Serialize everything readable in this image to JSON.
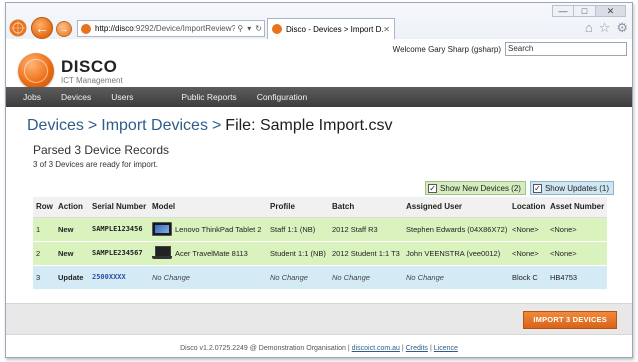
{
  "browser": {
    "address": {
      "host": "http://disco",
      "rest": ":9292/Device/ImportReview?Imp"
    },
    "address_icons": [
      "search-icon",
      "dropdown-icon",
      "refresh-icon"
    ],
    "tab_title": "Disco - Devices > Import D...",
    "chrome_icons": [
      "home-icon",
      "favorites-icon",
      "settings-icon"
    ]
  },
  "welcome": {
    "text": "Welcome Gary Sharp (gsharp)",
    "search_placeholder": "Search"
  },
  "brand": {
    "name": "DISCO",
    "subtitle": "ICT Management"
  },
  "menu": [
    "Jobs",
    "Devices",
    "Users",
    "Public Reports",
    "Configuration"
  ],
  "breadcrumb": {
    "link1": "Devices",
    "link2": "Import Devices",
    "separator": ">",
    "current": "File: Sample Import.csv"
  },
  "section": {
    "title": "Parsed 3 Device Records",
    "subtitle": "3 of 3 Devices are ready for import."
  },
  "toggles": {
    "show_new": "Show New Devices (2)",
    "show_updates": "Show Updates (1)",
    "show_new_checked": true,
    "show_updates_checked": true
  },
  "table": {
    "headers": [
      "Row",
      "Action",
      "Serial Number",
      "Model",
      "Profile",
      "Batch",
      "Assigned User",
      "Location",
      "Asset Number"
    ],
    "rows": [
      {
        "row": "1",
        "action": "New",
        "serial": "SAMPLE123456",
        "model": "Lenovo ThinkPad Tablet 2",
        "profile": "Staff 1:1 (NB)",
        "batch": "2012 Staff R3",
        "user": "Stephen Edwards (04X86X72)",
        "location": "<None>",
        "asset": "<None>"
      },
      {
        "row": "2",
        "action": "New",
        "serial": "SAMPLE234567",
        "model": "Acer TravelMate 8113",
        "profile": "Student 1:1 (NB)",
        "batch": "2012 Student 1:1 T3",
        "user": "John VEENSTRA (vee0012)",
        "location": "<None>",
        "asset": "<None>"
      },
      {
        "row": "3",
        "action": "Update",
        "serial": "2500XXXX",
        "model": "No Change",
        "profile": "No Change",
        "batch": "No Change",
        "user": "No Change",
        "location": "Block C",
        "asset": "HB4753"
      }
    ]
  },
  "import_button": "IMPORT 3 DEVICES",
  "footer": {
    "text": "Disco v1.2.0725.2249 @ Demonstration Organisation |",
    "link1": "discoict.com.au",
    "link2": "Credits",
    "link3": "Licence",
    "sep": "|"
  },
  "colors": {
    "accent": "#e8731c",
    "new_row": "#d9f2be",
    "update_row": "#d4ebf6",
    "menubar": "#4a4a4a"
  }
}
